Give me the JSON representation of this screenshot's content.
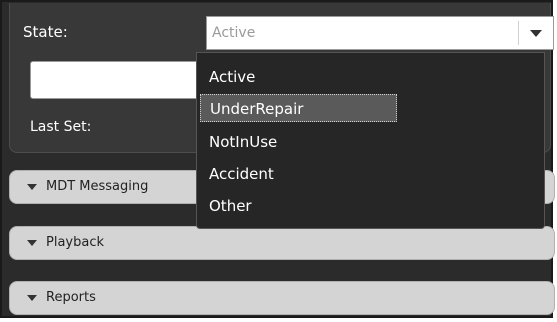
{
  "state_field": {
    "label": "State:",
    "selected_value": "Active",
    "options": [
      "Active",
      "UnderRepair",
      "NotInUse",
      "Accident",
      "Other"
    ],
    "highlighted_option": "UnderRepair"
  },
  "text_field": {
    "value": ""
  },
  "last_set": {
    "label": "Last Set:"
  },
  "sections": [
    {
      "label": "MDT Messaging"
    },
    {
      "label": "Playback"
    },
    {
      "label": "Reports"
    }
  ],
  "colors": {
    "panel_background": "#383838",
    "frame_background": "#2b2b2b",
    "dropdown_background": "#262626",
    "selected_option_background": "#5a5a5a",
    "accordion_background": "#d4d4d4",
    "placeholder_text": "#9a9a9a"
  },
  "icons": {
    "select_arrow": "chevron-down-icon",
    "section_caret": "caret-down-icon"
  }
}
